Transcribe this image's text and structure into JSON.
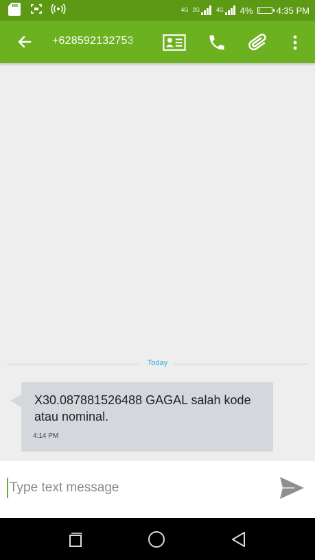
{
  "status_bar": {
    "sim1_network": "4G",
    "sim2_network": "2G",
    "sim3_network": "4G",
    "battery_percent": "4%",
    "battery_level": 0.04,
    "time": "4:35 PM",
    "icons": [
      "sd-card-icon",
      "screenshot-icon",
      "hotspot-icon",
      "volte-icon",
      "signal-icon",
      "battery-icon"
    ]
  },
  "toolbar": {
    "title": "+628592132753",
    "icons": [
      "back-arrow-icon",
      "contact-card-icon",
      "phone-icon",
      "attachment-icon",
      "more-vert-icon"
    ]
  },
  "conversation": {
    "date_divider": "Today",
    "messages": [
      {
        "text": "X30.087881526488 GAGAL salah kode atau nominal.",
        "time": "4:14 PM"
      }
    ]
  },
  "compose": {
    "placeholder": "Type text message",
    "value": "",
    "send_icon": "send-icon"
  },
  "nav_bar": {
    "icons": [
      "recent-apps-icon",
      "home-icon",
      "back-icon"
    ]
  },
  "colors": {
    "status_bar": "#5c9a16",
    "toolbar": "#6cb120",
    "background": "#eeeeee",
    "bubble": "#d4d7dc",
    "accent_blue": "#2aa6e0",
    "send": "#8f8f8f"
  }
}
